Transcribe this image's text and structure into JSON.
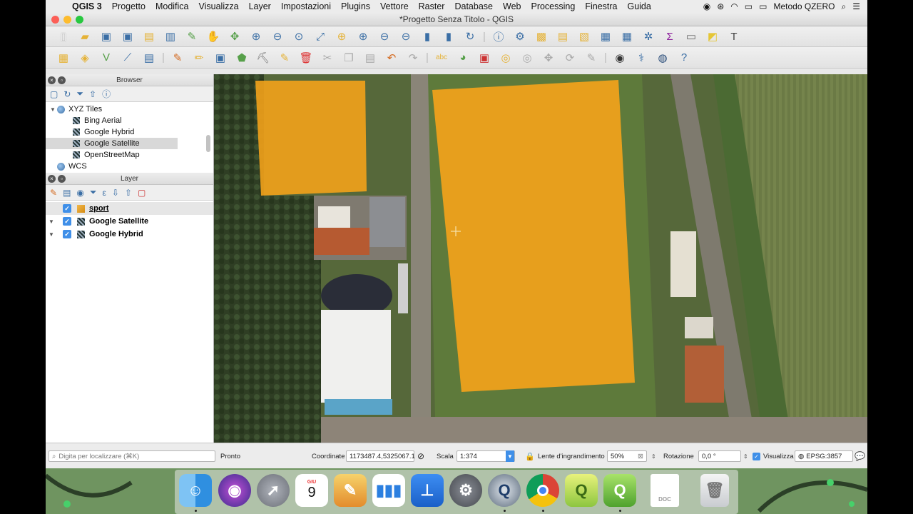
{
  "menubar": {
    "apple": "",
    "app": "QGIS 3",
    "items": [
      "Progetto",
      "Modifica",
      "Visualizza",
      "Layer",
      "Impostazioni",
      "Plugins",
      "Vettore",
      "Raster",
      "Database",
      "Web",
      "Processing",
      "Finestra",
      "Guida"
    ],
    "user": "Metodo QZERO"
  },
  "window": {
    "title": "*Progetto Senza Titolo - QGIS"
  },
  "browser": {
    "header": "Browser",
    "items": [
      {
        "label": "XYZ Tiles",
        "kind": "group"
      },
      {
        "label": "Bing Aerial",
        "kind": "tile"
      },
      {
        "label": "Google Hybrid",
        "kind": "tile"
      },
      {
        "label": "Google Satellite",
        "kind": "tile",
        "selected": true
      },
      {
        "label": "OpenStreetMap",
        "kind": "tile"
      },
      {
        "label": "WCS",
        "kind": "group"
      }
    ]
  },
  "layers": {
    "header": "Layer",
    "items": [
      {
        "label": "sport",
        "checked": true,
        "icon": "polygon-layer-icon",
        "selected": true
      },
      {
        "label": "Google Satellite",
        "checked": true,
        "icon": "raster-tile-icon"
      },
      {
        "label": "Google Hybrid",
        "checked": true,
        "icon": "raster-tile-icon"
      }
    ]
  },
  "status": {
    "search_placeholder": "Digita per localizzare (⌘K)",
    "ready": "Pronto",
    "coord_label": "Coordinate",
    "coord_value": "1173487.4,5325067.1",
    "scale_label": "Scala",
    "scale_value": "1:374",
    "magnifier_label": "Lente d'ingrandimento",
    "magnifier_value": "50%",
    "rotation_label": "Rotazione",
    "rotation_value": "0,0 °",
    "render_label": "Visualizza",
    "crs": "EPSG:3857"
  },
  "dock": {
    "calendar_month": "GIU",
    "calendar_day": "9",
    "doc_label": "DOC"
  },
  "colors": {
    "polygon_fill": "#f3a21b",
    "selection": "#3f8fe8"
  }
}
